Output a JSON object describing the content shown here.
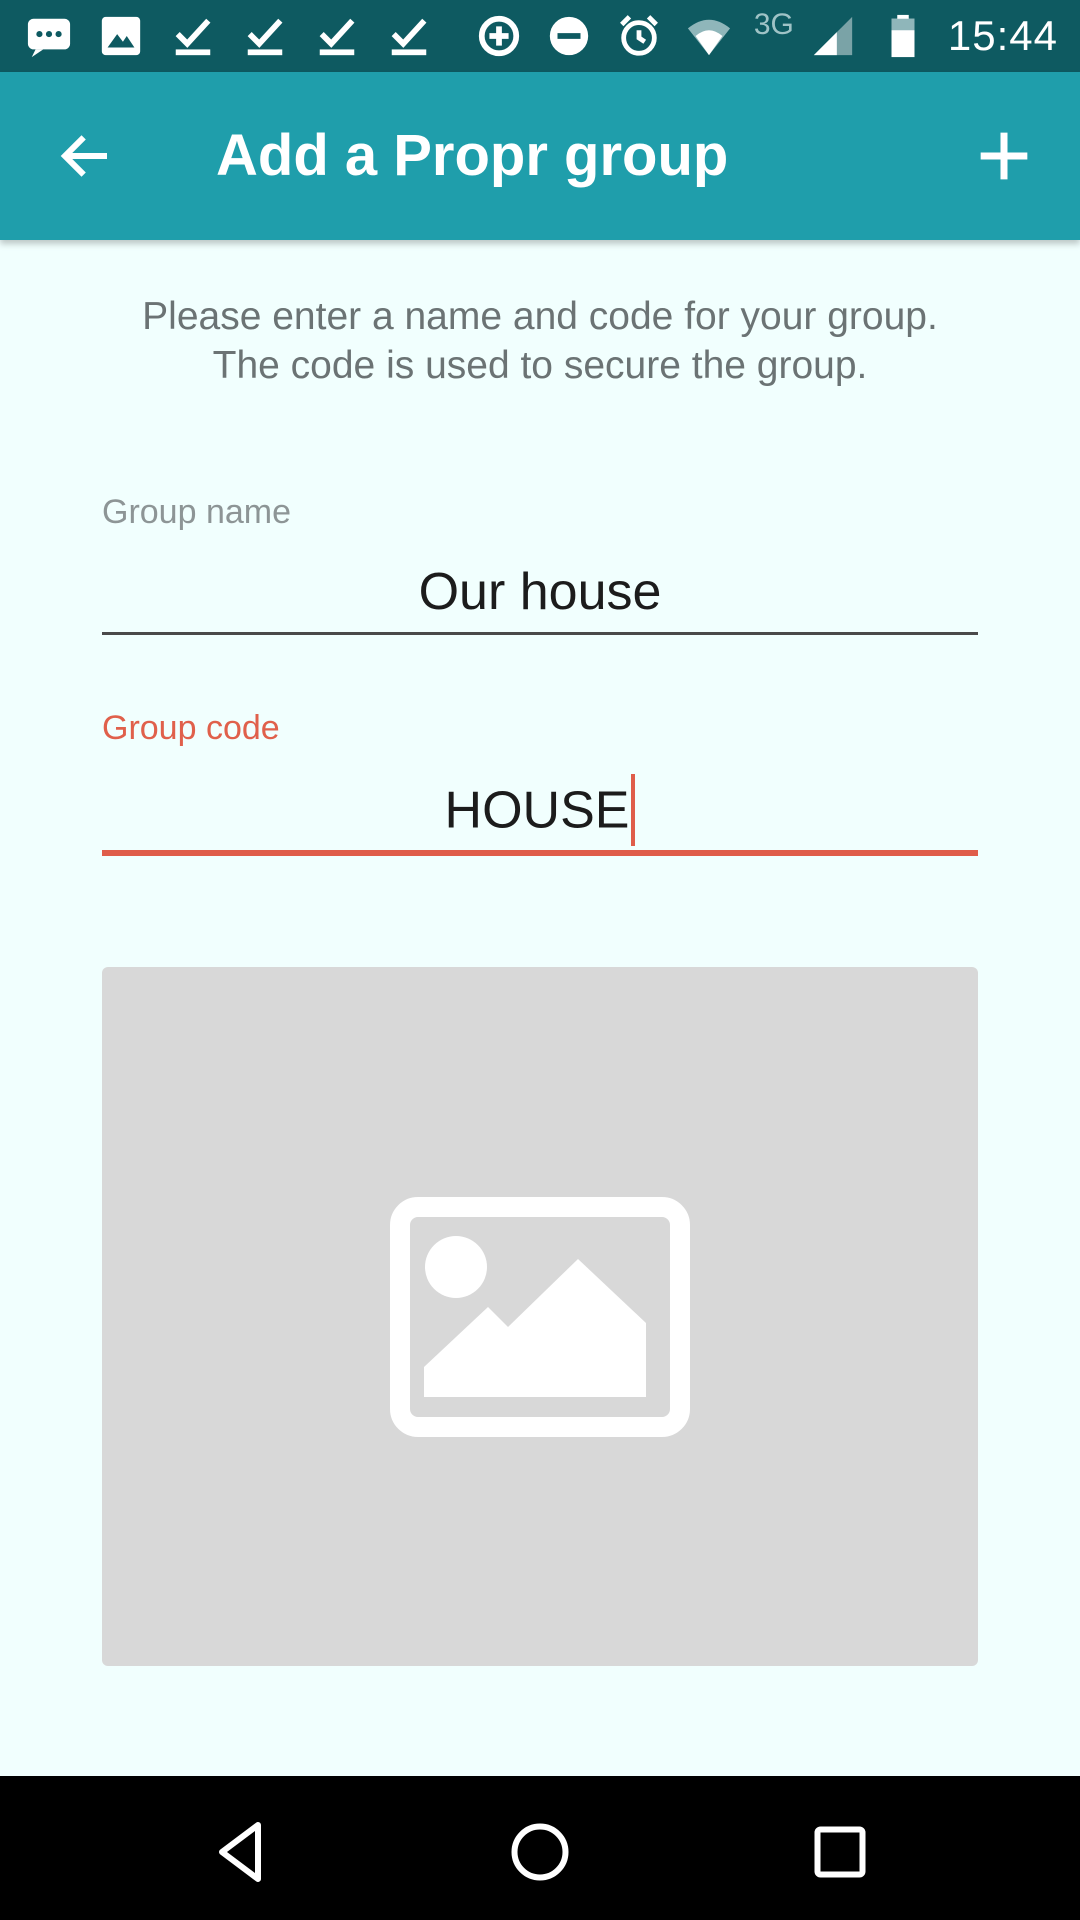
{
  "status_bar": {
    "time": "15:44",
    "network_type": "3G",
    "icons": [
      "messages-icon",
      "image-icon",
      "download-done-icon",
      "download-done-icon",
      "download-done-icon",
      "download-done-icon",
      "data-saver-icon",
      "do-not-disturb-icon",
      "alarm-icon",
      "wifi-icon",
      "signal-icon",
      "battery-icon"
    ]
  },
  "app_bar": {
    "title": "Add a Propr group",
    "back_icon": "arrow-back-icon",
    "action_icon": "add-icon",
    "background_color": "#1f9eab"
  },
  "form": {
    "intro": "Please enter a name and code for your group. The code is used to secure the group.",
    "group_name": {
      "label": "Group name",
      "value": "Our house"
    },
    "group_code": {
      "label": "Group code",
      "value": "HOUSE",
      "focused": true,
      "accent_color": "#df5d4a"
    },
    "image_placeholder_icon": "image-placeholder-icon"
  },
  "nav_bar": {
    "icons": [
      "nav-back-icon",
      "nav-home-icon",
      "nav-recents-icon"
    ]
  }
}
